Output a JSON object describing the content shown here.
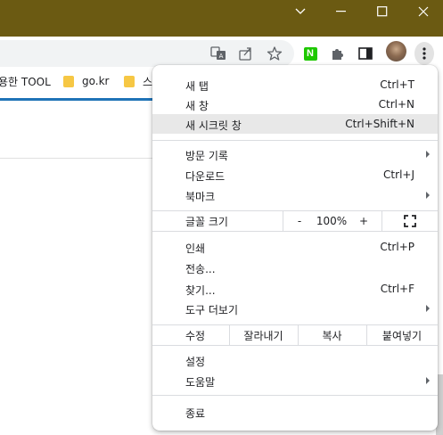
{
  "window": {
    "controls": [
      "chevron-down",
      "minimize",
      "maximize",
      "close"
    ]
  },
  "toolbar": {
    "icons": [
      "translate-icon",
      "share-icon",
      "star-icon",
      "naver-extension-icon",
      "extensions-puzzle-icon",
      "side-panel-icon",
      "profile-avatar",
      "menu-kebab-icon"
    ],
    "naver_letter": "N",
    "accent_green": "#1ec800"
  },
  "bookmarks": {
    "items": [
      {
        "label": "용한 TOOL"
      },
      {
        "label": "go.kr"
      },
      {
        "label": "스"
      }
    ]
  },
  "menu": {
    "items": {
      "new_tab": {
        "label": "새 탭",
        "shortcut": "Ctrl+T"
      },
      "new_window": {
        "label": "새 창",
        "shortcut": "Ctrl+N"
      },
      "incognito": {
        "label": "새 시크릿 창",
        "shortcut": "Ctrl+Shift+N"
      },
      "history": {
        "label": "방문 기록"
      },
      "downloads": {
        "label": "다운로드",
        "shortcut": "Ctrl+J"
      },
      "bookmarks": {
        "label": "북마크"
      },
      "print": {
        "label": "인쇄",
        "shortcut": "Ctrl+P"
      },
      "cast": {
        "label": "전송..."
      },
      "find": {
        "label": "찾기...",
        "shortcut": "Ctrl+F"
      },
      "more_tools": {
        "label": "도구 더보기"
      },
      "settings": {
        "label": "설정"
      },
      "help": {
        "label": "도움말"
      },
      "exit": {
        "label": "종료"
      }
    },
    "zoom": {
      "label": "글꼴 크기",
      "minus": "-",
      "value": "100%",
      "plus": "+"
    },
    "edit": {
      "label": "수정",
      "cut": "잘라내기",
      "copy": "복사",
      "paste": "붙여넣기"
    },
    "highlighted_item": "incognito"
  },
  "colors": {
    "titlebar": "#6b5a12",
    "menu_highlight": "#e8e8e8",
    "tab_indicator": "#1f73b7",
    "folder": "#f6c744"
  }
}
